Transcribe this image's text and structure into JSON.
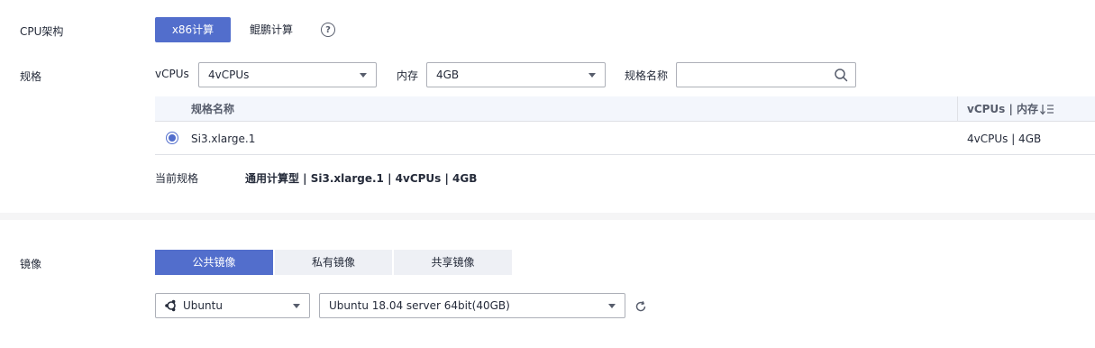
{
  "cpu": {
    "label": "CPU架构",
    "options": [
      "x86计算",
      "鲲鹏计算"
    ],
    "selected": "x86计算",
    "help_glyph": "?"
  },
  "spec": {
    "label": "规格",
    "vcpus_label": "vCPUs",
    "vcpus_value": "4vCPUs",
    "memory_label": "内存",
    "memory_value": "4GB",
    "name_label": "规格名称",
    "name_value": ""
  },
  "table": {
    "headers": [
      "规格名称",
      "vCPUs | 内存"
    ],
    "rows": [
      {
        "name": "Si3.xlarge.1",
        "cpu_mem": "4vCPUs | 4GB",
        "selected": true
      }
    ]
  },
  "current_spec": {
    "label": "当前规格",
    "value": "通用计算型 | Si3.xlarge.1 | 4vCPUs | 4GB"
  },
  "image": {
    "label": "镜像",
    "tabs": [
      "公共镜像",
      "私有镜像",
      "共享镜像"
    ],
    "active_tab": "公共镜像",
    "os_value": "Ubuntu",
    "version_value": "Ubuntu 18.04 server 64bit(40GB)"
  },
  "colors": {
    "accent": "#526ecc",
    "band": "#f5f5f6",
    "table_head": "#f3f6fc"
  }
}
